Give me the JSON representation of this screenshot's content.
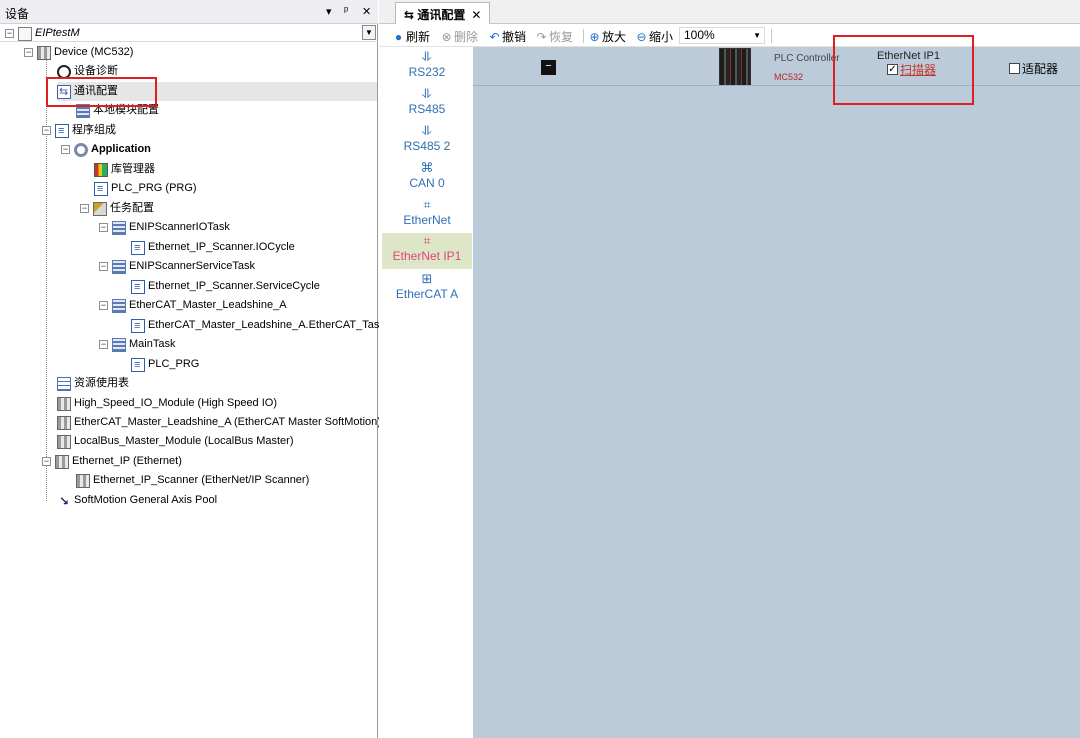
{
  "left_pane": {
    "title": "设备",
    "buttons": {
      "dropdown": "▾",
      "pin": "ᵖ",
      "close": "✕"
    }
  },
  "tree": {
    "project": "EIPtestM",
    "device": "Device (MC532)",
    "diagnostics": "设备诊断",
    "comm_config": "通讯配置",
    "local_module": "本地模块配置",
    "program_group": "程序组成",
    "application": "Application",
    "library_manager": "库管理器",
    "plc_prg": "PLC_PRG (PRG)",
    "task_config": "任务配置",
    "tasks": [
      {
        "name": "ENIPScannerIOTask",
        "call": "Ethernet_IP_Scanner.IOCycle"
      },
      {
        "name": "ENIPScannerServiceTask",
        "call": "Ethernet_IP_Scanner.ServiceCycle"
      },
      {
        "name": "EtherCAT_Master_Leadshine_A",
        "call": "EtherCAT_Master_Leadshine_A.EtherCAT_Task"
      },
      {
        "name": "MainTask",
        "call": "PLC_PRG"
      }
    ],
    "resource_table": "资源使用表",
    "modules": [
      "High_Speed_IO_Module (High Speed IO)",
      "EtherCAT_Master_Leadshine_A (EtherCAT Master SoftMotion)",
      "LocalBus_Master_Module (LocalBus Master)"
    ],
    "ethernet_ip": "Ethernet_IP (Ethernet)",
    "eip_scanner": "Ethernet_IP_Scanner (EtherNet/IP Scanner)",
    "axis_pool": "SoftMotion General Axis Pool"
  },
  "editor": {
    "tab_label": "通讯配置",
    "tab_close": "✕",
    "toolbar": {
      "refresh": "刷新",
      "delete": "删除",
      "undo": "撤销",
      "redo": "恢复",
      "zoom_in": "放大",
      "zoom_out": "缩小",
      "zoom_level": "100%"
    },
    "sidebar": [
      {
        "label": "RS232",
        "icon": "serial-icon"
      },
      {
        "label": "RS485",
        "icon": "serial-icon"
      },
      {
        "label": "RS485 2",
        "icon": "serial-icon"
      },
      {
        "label": "CAN 0",
        "icon": "can-bus-icon"
      },
      {
        "label": "EtherNet",
        "icon": "ethernet-icon"
      },
      {
        "label": "EtherNet IP1",
        "icon": "ethernet-ip-icon",
        "active": true
      },
      {
        "label": "EtherCAT A",
        "icon": "ethercat-icon"
      }
    ],
    "canvas": {
      "collapse": "−",
      "plc_label": "PLC Controller",
      "plc_model": "MC532",
      "eip_title": "EtherNet IP1",
      "scanner_label": "扫描器",
      "scanner_checked": true,
      "adapter_label": "适配器",
      "adapter_checked": false
    }
  },
  "colors": {
    "canvas_bg": "#bccbda",
    "link_blue": "#2f6fb5",
    "active_pink": "#e0457b",
    "active_bg": "#dde6c6",
    "highlight_red": "#e02020"
  }
}
